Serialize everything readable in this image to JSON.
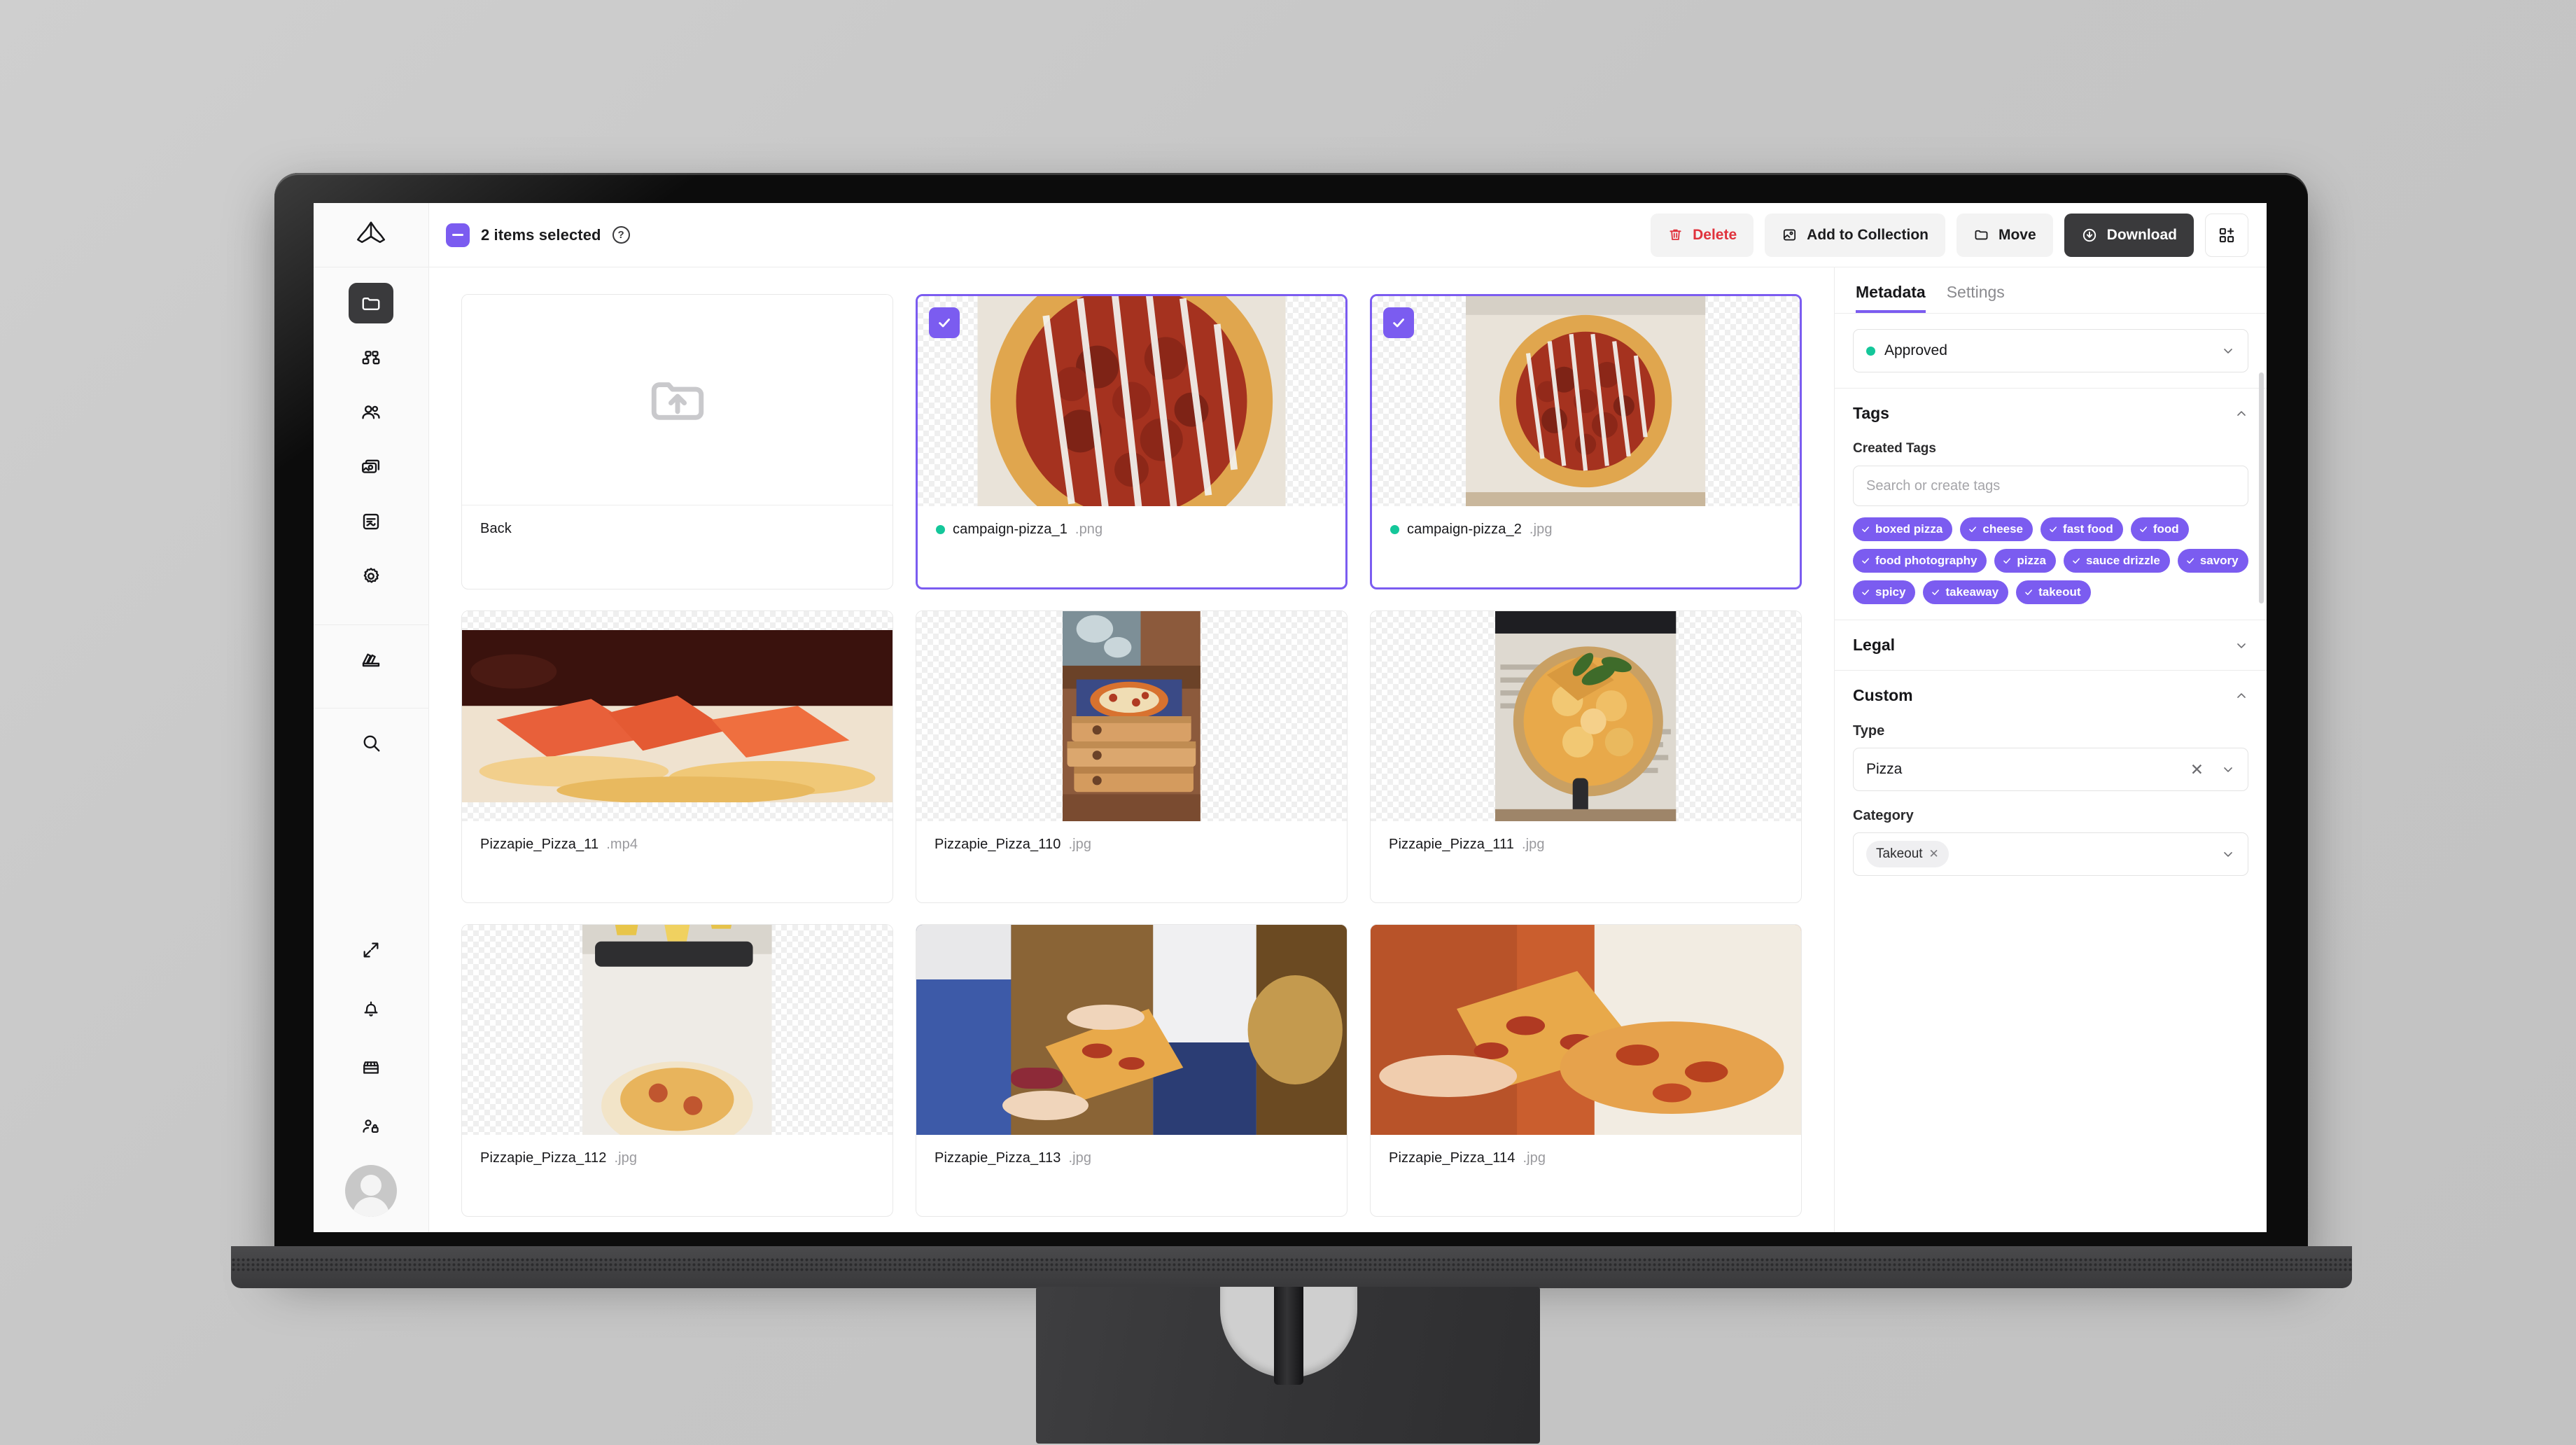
{
  "app": {
    "logo_icon": "tripod-logo-icon"
  },
  "sidebar": {
    "items": [
      {
        "name": "folder",
        "icon": "folder-icon",
        "active": true
      },
      {
        "name": "workflows",
        "icon": "nodes-icon",
        "active": false
      },
      {
        "name": "people",
        "icon": "users-icon",
        "active": false
      },
      {
        "name": "media",
        "icon": "images-icon",
        "active": false
      },
      {
        "name": "reports",
        "icon": "report-icon",
        "active": false
      },
      {
        "name": "settings",
        "icon": "gear-icon",
        "active": false
      },
      {
        "name": "brand",
        "icon": "swatches-icon",
        "active": false
      },
      {
        "name": "search",
        "icon": "search-icon",
        "active": false
      }
    ],
    "bottom_items": [
      {
        "name": "expand",
        "icon": "expand-arrows-icon"
      },
      {
        "name": "notifications",
        "icon": "bell-icon"
      },
      {
        "name": "store",
        "icon": "storefront-icon"
      },
      {
        "name": "permissions",
        "icon": "user-lock-icon"
      }
    ]
  },
  "toolbar": {
    "selection_label": "2 items selected",
    "help_glyph": "?",
    "delete_label": "Delete",
    "add_to_collection_label": "Add to Collection",
    "move_label": "Move",
    "download_label": "Download",
    "grid_add_icon": "grid-plus-icon",
    "delete_color": "#e0323c",
    "primary_bg": "#3a3a3c",
    "accent": "#7b5cf0"
  },
  "grid": {
    "back_card": {
      "label": "Back",
      "icon": "folder-upload-icon"
    },
    "items": [
      {
        "name": "campaign-pizza_1",
        "ext": ".png",
        "selected": true,
        "status_color": "#14c79a",
        "art": "pizza-box-pepperoni"
      },
      {
        "name": "campaign-pizza_2",
        "ext": ".jpg",
        "selected": true,
        "status_color": "#14c79a",
        "art": "pizza-box-pepperoni"
      },
      {
        "name": "Pizzapie_Pizza_11",
        "ext": ".mp4",
        "selected": false,
        "status_color": null,
        "art": "pizza-slices-dark"
      },
      {
        "name": "Pizzapie_Pizza_110",
        "ext": ".jpg",
        "selected": false,
        "status_color": null,
        "art": "stacked-pizza-boxes"
      },
      {
        "name": "Pizzapie_Pizza_111",
        "ext": ".jpg",
        "selected": false,
        "status_color": null,
        "art": "pizza-on-newspaper"
      },
      {
        "name": "Pizzapie_Pizza_112",
        "ext": ".jpg",
        "selected": false,
        "status_color": null,
        "art": "table-drinks"
      },
      {
        "name": "Pizzapie_Pizza_113",
        "ext": ".jpg",
        "selected": false,
        "status_color": null,
        "art": "person-holding-slice"
      },
      {
        "name": "Pizzapie_Pizza_114",
        "ext": ".jpg",
        "selected": false,
        "status_color": null,
        "art": "hand-pizza-closeup"
      }
    ]
  },
  "panel": {
    "tabs": [
      {
        "label": "Metadata",
        "active": true
      },
      {
        "label": "Settings",
        "active": false
      }
    ],
    "status": {
      "value": "Approved",
      "dot_color": "#14c79a"
    },
    "tags_section": {
      "title": "Tags",
      "expanded": true,
      "created_tags_label": "Created Tags",
      "search_placeholder": "Search or create tags",
      "tags": [
        "boxed pizza",
        "cheese",
        "fast food",
        "food",
        "food photography",
        "pizza",
        "sauce drizzle",
        "savory",
        "spicy",
        "takeaway",
        "takeout"
      ],
      "tag_color": "#7b5cf0"
    },
    "legal_section": {
      "title": "Legal",
      "expanded": false
    },
    "custom_section": {
      "title": "Custom",
      "expanded": true,
      "fields": [
        {
          "label": "Type",
          "value": "Pizza",
          "clearable": true,
          "kind": "select"
        },
        {
          "label": "Category",
          "value": "Takeout",
          "clearable": true,
          "kind": "multiselect"
        }
      ]
    }
  }
}
